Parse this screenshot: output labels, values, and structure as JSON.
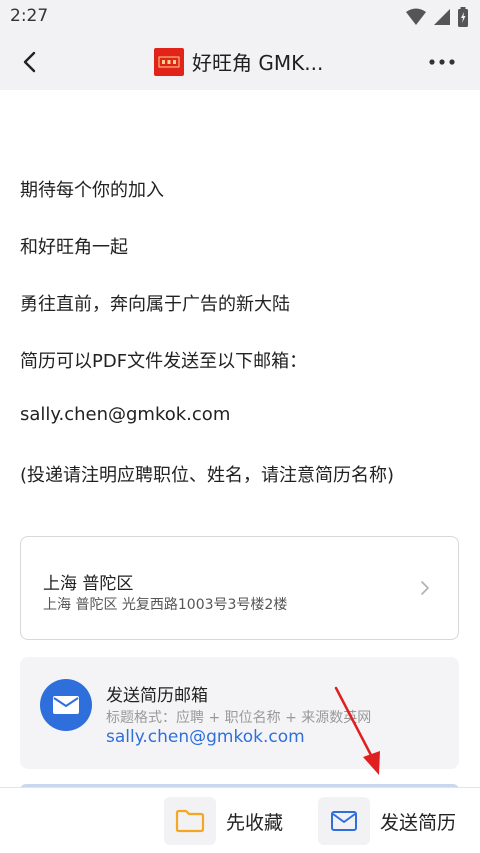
{
  "status_bar": {
    "time": "2:27"
  },
  "header": {
    "title": "好旺角 GMK..."
  },
  "body": {
    "lines": [
      "期待每个你的加入",
      "和好旺角一起",
      "勇往直前，奔向属于广告的新大陆",
      "简历可以PDF文件发送至以下邮箱：",
      "sally.chen@gmkok.com",
      "(投递请注明应聘职位、姓名，请注意简历名称)"
    ]
  },
  "address_card": {
    "title": "上海 普陀区",
    "detail": "上海 普陀区 光复西路1003号3号楼2楼"
  },
  "email_card": {
    "title": "发送简历邮箱",
    "hint": "标题格式：应聘 + 职位名称 + 来源数英网",
    "address": "sally.chen@gmkok.com"
  },
  "bottom_bar": {
    "collect_label": "先收藏",
    "send_label": "发送简历"
  },
  "colors": {
    "accent": "#2f6fdc",
    "logo": "#e2231a",
    "annotation_arrow": "#e02020",
    "collect_icon": "#f5a623"
  },
  "icons": {
    "back": "back-arrow-icon",
    "more": "more-dots-icon",
    "chevron": "chevron-right-icon",
    "mail": "mail-icon",
    "folder": "folder-icon"
  }
}
